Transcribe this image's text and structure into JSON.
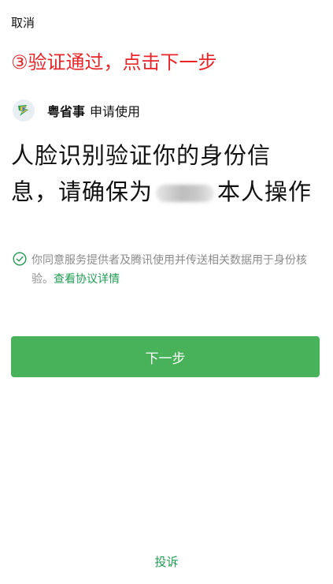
{
  "header": {
    "cancel_label": "取消"
  },
  "annotation": {
    "text": "③验证通过，点击下一步",
    "color": "#e8262a"
  },
  "app": {
    "icon": "app-logo-icon",
    "name": "粤省事",
    "suffix": "申请使用"
  },
  "heading": {
    "line1": "人脸识别验证你的身份信",
    "line2_prefix": "息，请确保为",
    "line2_suffix": "本人操作"
  },
  "agreement": {
    "icon": "check-circle-icon",
    "text": "你同意服务提供者及腾讯使用并传送相关数据用于身份核验。",
    "link_label": "查看协议详情"
  },
  "primary_button": {
    "label": "下一步",
    "color": "#48b25a"
  },
  "footer": {
    "complain_label": "投诉",
    "accent_color": "#1f9d53"
  }
}
